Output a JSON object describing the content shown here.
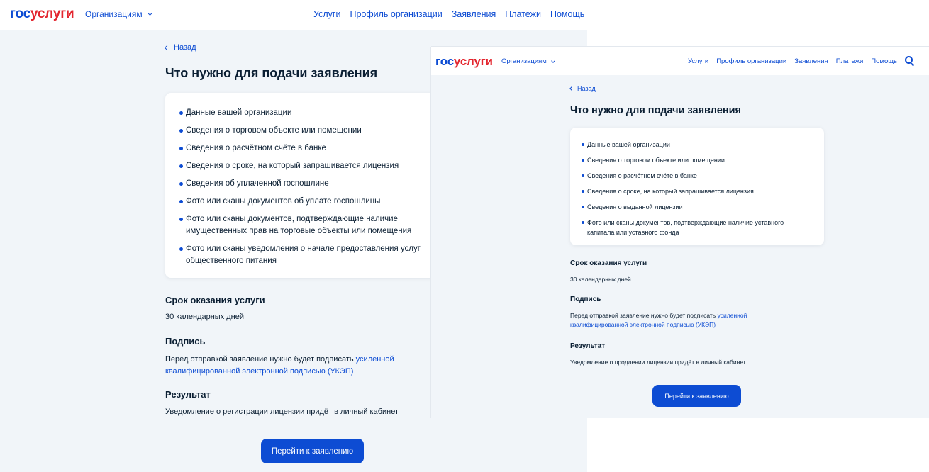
{
  "colors": {
    "brand_blue": "#0d4cd3",
    "brand_red": "#e3262f",
    "text": "#0b1f33",
    "page_bg": "#f1f5f9"
  },
  "left": {
    "header": {
      "logo_part1": "гос",
      "logo_part2": "услуги",
      "org_menu": "Организациям",
      "nav": [
        "Услуги",
        "Профиль организации",
        "Заявления",
        "Платежи",
        "Помощь"
      ]
    },
    "back_label": "Назад",
    "title": "Что нужно для подачи заявления",
    "requirements": [
      "Данные вашей организации",
      "Сведения о торговом объекте или помещении",
      "Сведения о расчётном счёте в банке",
      "Сведения о сроке, на который запрашивается лицензия",
      "Сведения об уплаченной госпошлине",
      "Фото или сканы документов об уплате госпошлины",
      "Фото или сканы документов, подтверждающие наличие имущественных прав на торговые объекты или помещения",
      "Фото или сканы уведомления о начале предоставления услуг общественного питания"
    ],
    "term_heading": "Срок оказания услуги",
    "term_text": "30 календарных дней",
    "signature_heading": "Подпись",
    "signature_text": "Перед отправкой заявление нужно будет подписать",
    "signature_link": "усиленной квалифицированной электронной подписью (УКЭП)",
    "result_heading": "Результат",
    "result_text": "Уведомление о регистрации лицензии придёт в личный кабинет",
    "button": "Перейти к заявлению"
  },
  "right": {
    "header": {
      "logo_part1": "гос",
      "logo_part2": "услуги",
      "org_menu": "Организациям",
      "nav": [
        "Услуги",
        "Профиль организации",
        "Заявления",
        "Платежи",
        "Помощь"
      ]
    },
    "back_label": "Назад",
    "title": "Что нужно для подачи заявления",
    "requirements": [
      "Данные вашей организации",
      "Сведения о торговом объекте или помещении",
      "Сведения о расчётном счёте в банке",
      "Сведения о сроке, на который запрашивается лицензия",
      "Сведения о выданной лицензии",
      "Фото или сканы документов, подтверждающие наличие уставного капитала или уставного фонда"
    ],
    "term_heading": "Срок оказания услуги",
    "term_text": "30 календарных дней",
    "signature_heading": "Подпись",
    "signature_text": "Перед отправкой заявление нужно будет подписать",
    "signature_link": "усиленной квалифицированной электронной подписью (УКЭП)",
    "result_heading": "Результат",
    "result_text": "Уведомление о продлении лицензии придёт в личный кабинет",
    "button": "Перейти к заявлению"
  }
}
